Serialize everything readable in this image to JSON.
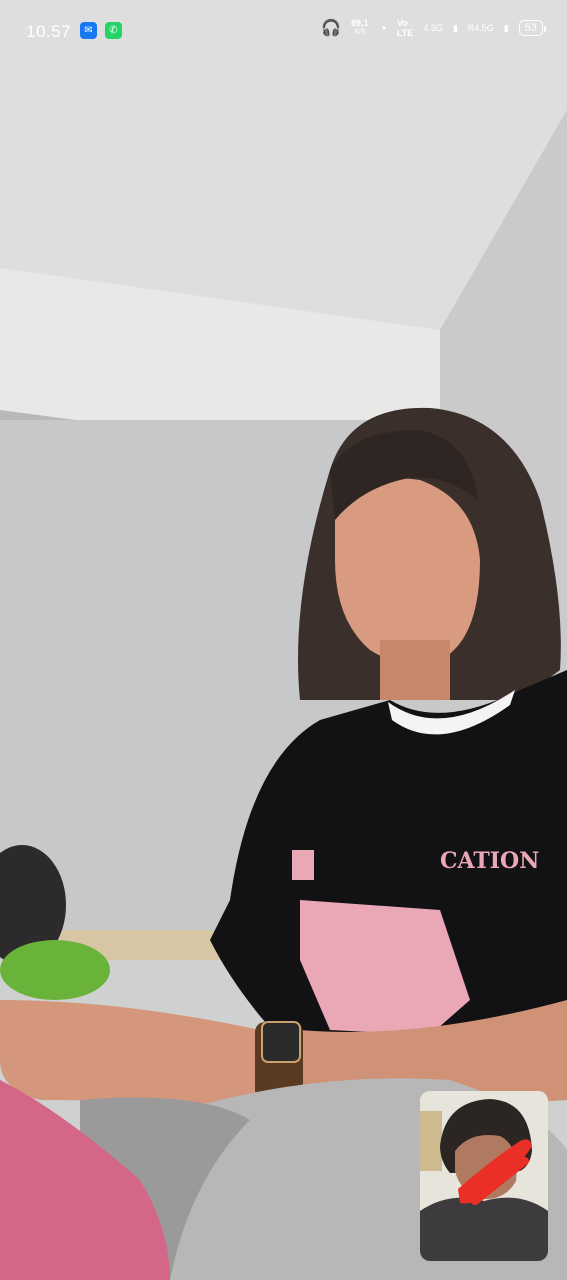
{
  "status_bar": {
    "time": "10.57",
    "net_speed_value": "89,1",
    "net_speed_unit": "K/S",
    "volte_top": "Vo",
    "volte_bottom": "LTE",
    "sim1_network": "4.5G",
    "sim2_network": "R4.5G",
    "battery_level": "53",
    "notification_icons": [
      "messenger-icon",
      "whatsapp-icon"
    ]
  },
  "call": {
    "remote_video_label": "remote-video",
    "self_preview_label": "self-preview"
  },
  "colors": {
    "wall": "#cfd0d0",
    "shirt": "#121214",
    "shirt_print": "#eaa7b5",
    "pip_annotation": "#ea2f26"
  }
}
